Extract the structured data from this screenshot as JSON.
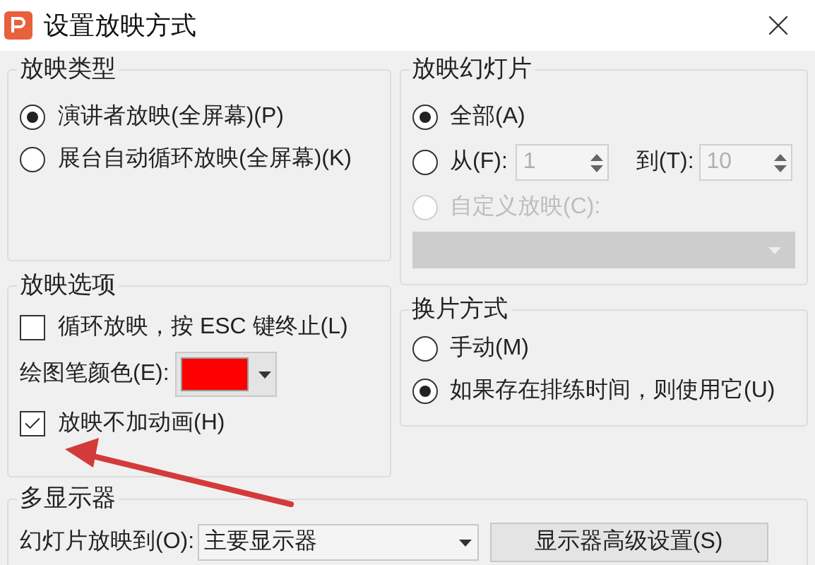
{
  "window": {
    "title": "设置放映方式"
  },
  "show_type": {
    "title": "放映类型",
    "options": [
      {
        "label": "演讲者放映(全屏幕)(P)",
        "selected": true
      },
      {
        "label": "展台自动循环放映(全屏幕)(K)",
        "selected": false
      }
    ]
  },
  "slides": {
    "title": "放映幻灯片",
    "options": [
      {
        "kind": "all",
        "label": "全部(A)",
        "selected": true,
        "disabled": false
      },
      {
        "kind": "range",
        "label": "从(F):",
        "selected": false,
        "disabled": false,
        "from_value": "1",
        "to_label": "到(T):",
        "to_value": "10"
      },
      {
        "kind": "custom",
        "label": "自定义放映(C):",
        "selected": false,
        "disabled": true
      }
    ]
  },
  "options": {
    "title": "放映选项",
    "loop": {
      "label": "循环放映，按 ESC 键终止(L)",
      "checked": false
    },
    "pen_color": {
      "label": "绘图笔颜色(E):",
      "color": "#ff0000"
    },
    "no_animation": {
      "label": "放映不加动画(H)",
      "checked": true
    }
  },
  "advance": {
    "title": "换片方式",
    "options": [
      {
        "label": "手动(M)",
        "selected": false
      },
      {
        "label": "如果存在排练时间，则使用它(U)",
        "selected": true
      }
    ]
  },
  "monitors": {
    "title": "多显示器",
    "label": "幻灯片放映到(O):",
    "value": "主要显示器",
    "button": "显示器高级设置(S)"
  }
}
